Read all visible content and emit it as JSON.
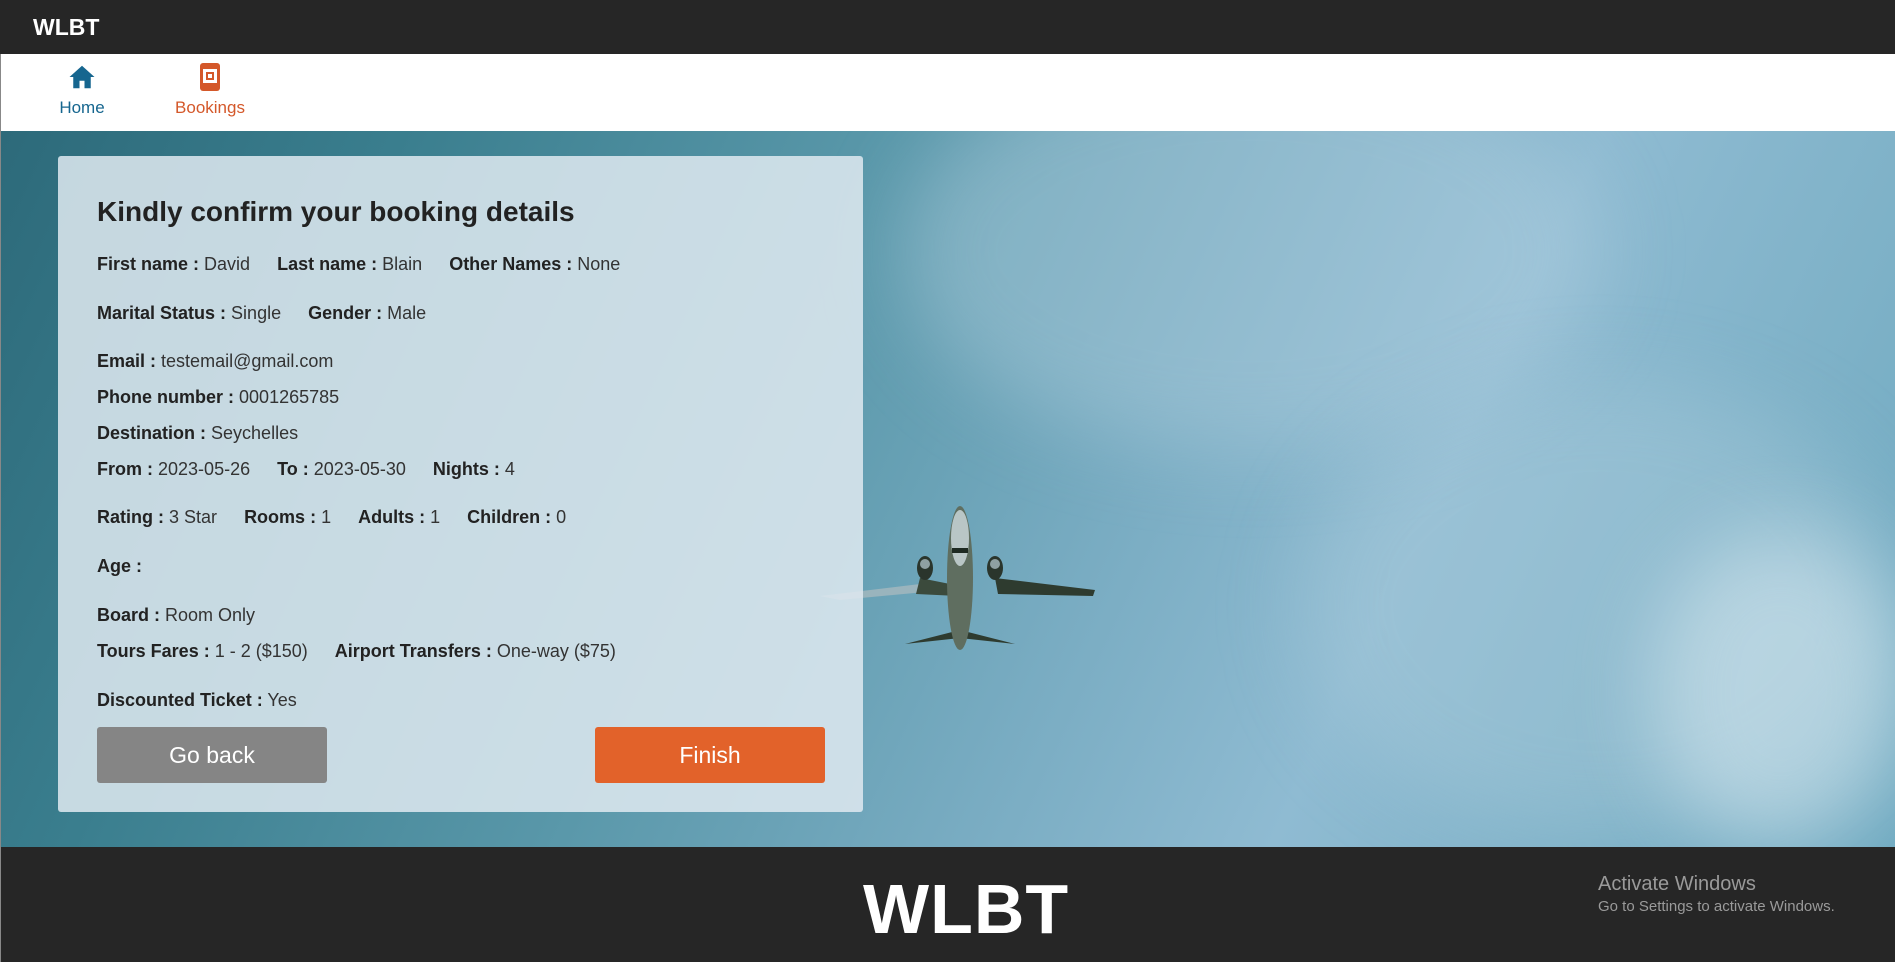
{
  "topbar": {
    "brand": "WLBT"
  },
  "nav": {
    "home": {
      "label": "Home",
      "icon": "home-icon"
    },
    "bookings": {
      "label": "Bookings",
      "icon": "bookings-icon"
    }
  },
  "card": {
    "title": "Kindly confirm your booking details",
    "first_name": {
      "label": "First name :",
      "value": "David"
    },
    "last_name": {
      "label": "Last name :",
      "value": "Blain"
    },
    "other_names": {
      "label": "Other Names :",
      "value": "None"
    },
    "marital_status": {
      "label": "Marital Status :",
      "value": "Single"
    },
    "gender": {
      "label": "Gender :",
      "value": "Male"
    },
    "email": {
      "label": "Email :",
      "value": "testemail@gmail.com"
    },
    "phone": {
      "label": "Phone number :",
      "value": "0001265785"
    },
    "destination": {
      "label": "Destination :",
      "value": "Seychelles"
    },
    "from": {
      "label": "From :",
      "value": "2023-05-26"
    },
    "to": {
      "label": "To :",
      "value": "2023-05-30"
    },
    "nights": {
      "label": "Nights :",
      "value": "4"
    },
    "rating": {
      "label": "Rating :",
      "value": "3 Star"
    },
    "rooms": {
      "label": "Rooms :",
      "value": "1"
    },
    "adults": {
      "label": "Adults :",
      "value": "1"
    },
    "children": {
      "label": "Children :",
      "value": "0"
    },
    "age": {
      "label": "Age :",
      "value": ""
    },
    "board": {
      "label": "Board :",
      "value": "Room Only"
    },
    "tours_fares": {
      "label": "Tours Fares :",
      "value": "1 - 2 ($150)"
    },
    "airport_transfers": {
      "label": "Airport Transfers :",
      "value": "One-way ($75)"
    },
    "discounted_ticket": {
      "label": "Discounted Ticket :",
      "value": "Yes"
    },
    "go_back_label": "Go back",
    "finish_label": "Finish"
  },
  "footer": {
    "logo": "WLBT",
    "activate_title": "Activate Windows",
    "activate_subtitle": "Go to Settings to activate Windows."
  },
  "colors": {
    "topbar_bg": "#262626",
    "nav_home": "#16668f",
    "nav_bookings": "#d4582a",
    "finish_button": "#e2622a",
    "back_button": "#858585"
  }
}
